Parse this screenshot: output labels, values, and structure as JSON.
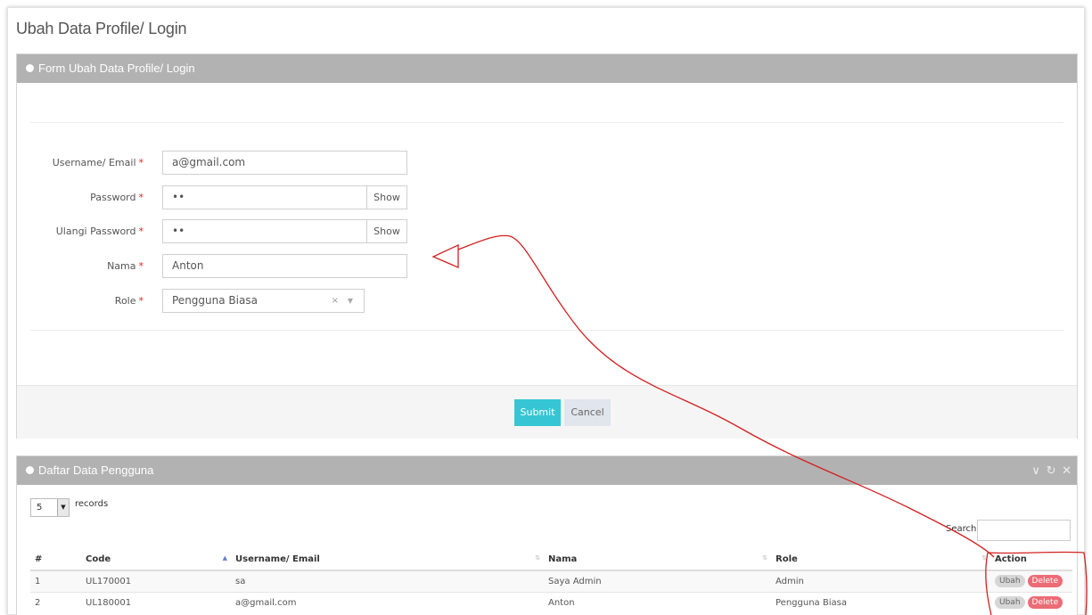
{
  "page": {
    "title": "Ubah Data Profile/ Login"
  },
  "form_panel": {
    "title": "Form Ubah Data Profile/ Login",
    "fields": {
      "username": {
        "label": "Username/ Email",
        "required_mark": "*",
        "value": "a@gmail.com"
      },
      "password": {
        "label": "Password",
        "required_mark": "*",
        "value": "••",
        "show_label": "Show"
      },
      "repeat_password": {
        "label": "Ulangi Password",
        "required_mark": "*",
        "value": "••",
        "show_label": "Show"
      },
      "name": {
        "label": "Nama",
        "required_mark": "*",
        "value": "Anton"
      },
      "role": {
        "label": "Role",
        "required_mark": "*",
        "value": "Pengguna Biasa",
        "clear_glyph": "×",
        "arrow_glyph": "▼"
      }
    },
    "submit_label": "Submit",
    "cancel_label": "Cancel"
  },
  "list_panel": {
    "title": "Daftar Data Pengguna",
    "tools": {
      "collapse": "∨",
      "reload": "↻",
      "remove": "✕"
    },
    "length": {
      "value": "5",
      "arrow": "▼",
      "suffix": "records"
    },
    "search_label": "Search:",
    "columns": [
      "#",
      "Code",
      "Username/ Email",
      "Nama",
      "Role",
      "Action"
    ],
    "rows": [
      {
        "no": "1",
        "code": "UL170001",
        "username": "sa",
        "nama": "Saya Admin",
        "role": "Admin",
        "ubah": "Ubah",
        "delete": "Delete"
      },
      {
        "no": "2",
        "code": "UL180001",
        "username": "a@gmail.com",
        "nama": "Anton",
        "role": "Pengguna Biasa",
        "ubah": "Ubah",
        "delete": "Delete"
      }
    ]
  },
  "colors": {
    "header": "#b2b2b2",
    "submit": "#36c6d3",
    "delete": "#ed6b75",
    "annotation": "#d42020"
  }
}
